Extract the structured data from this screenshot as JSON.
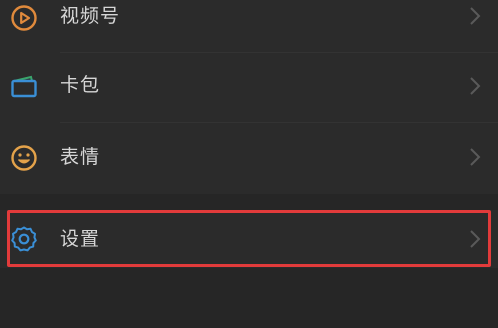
{
  "menu": {
    "items": [
      {
        "label": "视频号",
        "icon": "channels-icon",
        "icon_color": "#e08a3c"
      },
      {
        "label": "卡包",
        "icon": "card-wallet-icon",
        "icon_color": "#3a8fd6"
      },
      {
        "label": "表情",
        "icon": "sticker-smile-icon",
        "icon_color": "#e3a24a"
      }
    ],
    "settings": {
      "label": "设置",
      "icon": "gear-icon",
      "icon_color": "#3a8fd6"
    }
  },
  "colors": {
    "background": "#262626",
    "row_background": "#2b2b2b",
    "text": "#d6d6d6",
    "chevron": "#5a5a5a",
    "highlight": "#e23b3b"
  }
}
